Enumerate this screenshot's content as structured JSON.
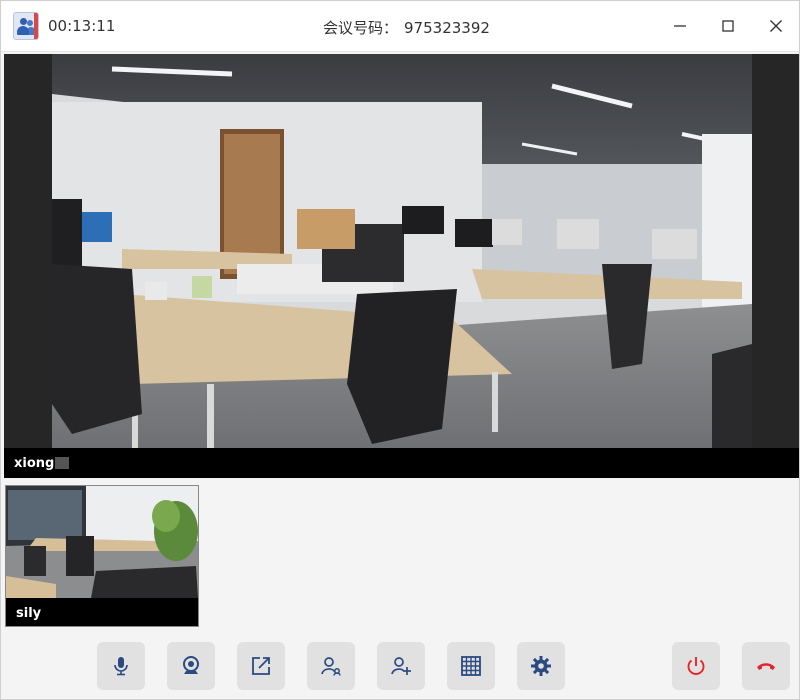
{
  "titlebar": {
    "timer": "00:13:11",
    "meeting_label": "会议号码：",
    "meeting_number": "975323392",
    "controls": [
      "minimize-icon",
      "maximize-icon",
      "close-icon"
    ]
  },
  "main_video": {
    "participant_name": "xiong"
  },
  "thumbnails": [
    {
      "participant_name": "sily"
    }
  ],
  "toolbar": {
    "buttons": [
      {
        "icon": "microphone-icon"
      },
      {
        "icon": "camera-icon"
      },
      {
        "icon": "share-screen-icon"
      },
      {
        "icon": "participants-icon"
      },
      {
        "icon": "add-participant-icon"
      },
      {
        "icon": "grid-layout-icon"
      },
      {
        "icon": "settings-icon"
      },
      {
        "icon": "power-icon"
      },
      {
        "icon": "hang-up-icon"
      }
    ]
  },
  "colors": {
    "end_red": "#e2272c",
    "icon_blue": "#2b4a80",
    "toolbar_button_bg": "#e1e1e1"
  }
}
